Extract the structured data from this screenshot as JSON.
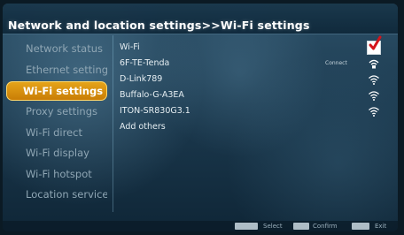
{
  "header": {
    "title": "Network and location settings>>Wi-Fi settings"
  },
  "sidebar": {
    "items": [
      {
        "label": "Network status",
        "active": false
      },
      {
        "label": "Ethernet settings",
        "active": false
      },
      {
        "label": "Wi-Fi settings",
        "active": true
      },
      {
        "label": "Proxy settings",
        "active": false
      },
      {
        "label": "Wi-Fi direct",
        "active": false
      },
      {
        "label": "Wi-Fi display",
        "active": false
      },
      {
        "label": "Wi-Fi hotspot",
        "active": false
      },
      {
        "label": "Location service",
        "active": false
      }
    ]
  },
  "wifi": {
    "toggle_label": "Wi-Fi",
    "enabled": true,
    "networks": [
      {
        "ssid": "6F-TE-Tenda",
        "status": "Connect",
        "icon": "wifi-signal-icon"
      },
      {
        "ssid": "D-Link789",
        "status": "",
        "icon": "wifi-signal-icon"
      },
      {
        "ssid": "Buffalo-G-A3EA",
        "status": "",
        "icon": "wifi-signal-icon"
      },
      {
        "ssid": "ITON-SR830G3.1",
        "status": "",
        "icon": "wifi-signal-icon"
      }
    ],
    "add_others_label": "Add others"
  },
  "footer": {
    "select_label": "Select",
    "confirm_label": "Confirm",
    "exit_label": "Exit"
  },
  "colors": {
    "accent": "#e5a41a",
    "check": "#d4141b",
    "background": "#1c3a4f"
  }
}
